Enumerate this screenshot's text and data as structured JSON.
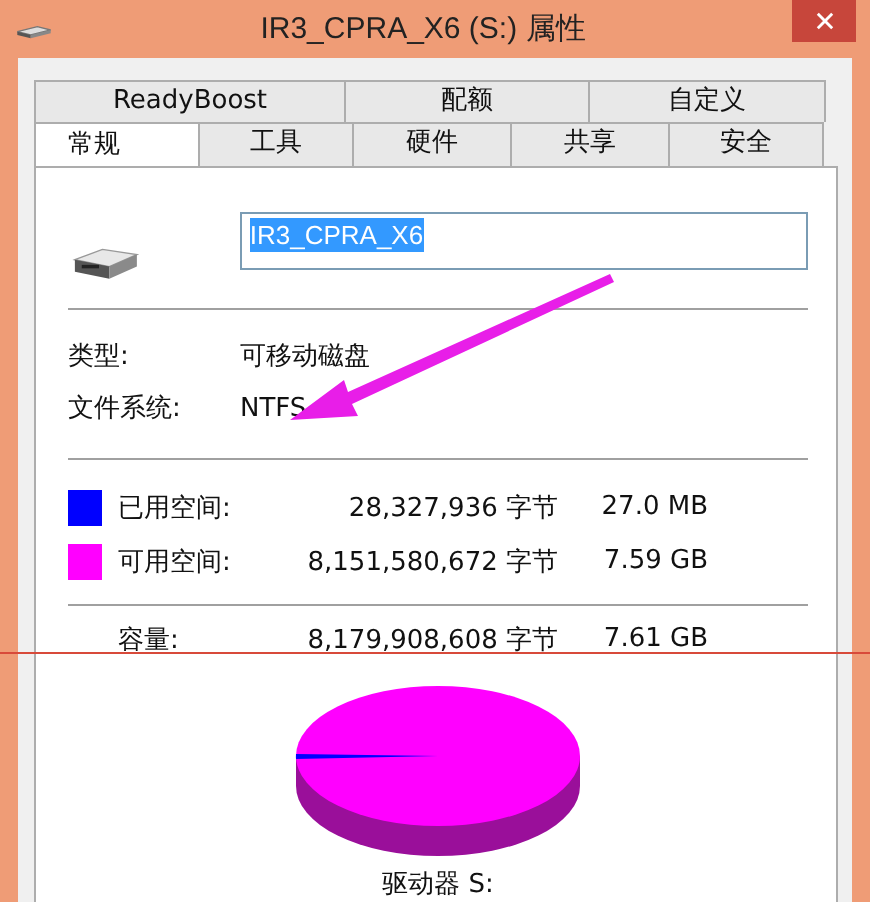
{
  "window": {
    "title": "IR3_CPRA_X6 (S:) 属性"
  },
  "tab_rows": [
    [
      {
        "label": "ReadyBoost",
        "selected": false
      },
      {
        "label": "配额",
        "selected": false
      },
      {
        "label": "自定义",
        "selected": false
      }
    ],
    [
      {
        "label": "常规",
        "selected": true
      },
      {
        "label": "工具",
        "selected": false
      },
      {
        "label": "硬件",
        "selected": false
      },
      {
        "label": "共享",
        "selected": false
      },
      {
        "label": "安全",
        "selected": false
      }
    ]
  ],
  "drive_name": {
    "value": "IR3_CPRA_X6",
    "text_selected": true
  },
  "properties": [
    {
      "label": "类型:",
      "value": "可移动磁盘"
    },
    {
      "label": "文件系统:",
      "value": "NTFS"
    }
  ],
  "space": [
    {
      "label": "已用空间:",
      "bytes": "28,327,936 字节",
      "size": "27.0 MB",
      "color": "#0000ff"
    },
    {
      "label": "可用空间:",
      "bytes": "8,151,580,672 字节",
      "size": "7.59 GB",
      "color": "#ff00ff"
    }
  ],
  "capacity": {
    "label": "容量:",
    "bytes": "8,179,908,608 字节",
    "size": "7.61 GB"
  },
  "drive_label": "驱动器 S:"
}
